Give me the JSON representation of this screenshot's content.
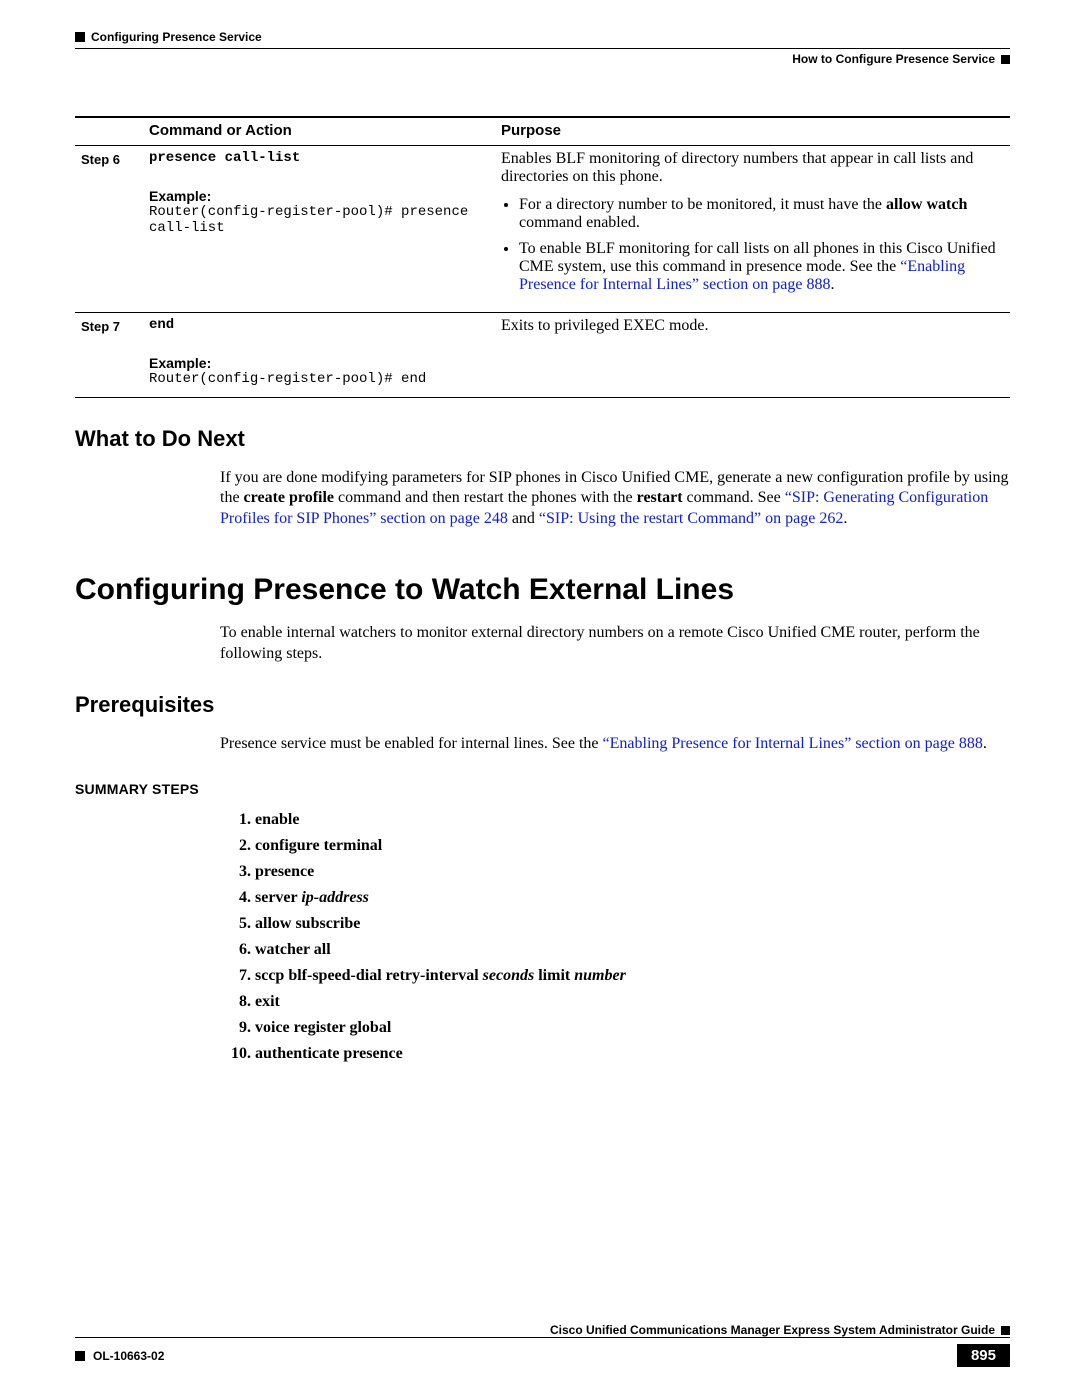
{
  "header": {
    "chapter": "Configuring Presence Service",
    "section": "How to Configure Presence Service"
  },
  "table": {
    "col1": "Command or Action",
    "col2": "Purpose",
    "rows": [
      {
        "step": "Step 6",
        "command": "presence call-list",
        "example_label": "Example:",
        "example_code": "Router(config-register-pool)# presence call-list",
        "purpose_intro": "Enables BLF monitoring of directory numbers that appear in call lists and directories on this phone.",
        "bullets": [
          {
            "pre": "For a directory number to be monitored, it must have the ",
            "bold": "allow watch",
            "post": " command enabled."
          },
          {
            "pre": "To enable BLF monitoring for call lists on all phones in this Cisco Unified CME system, use this command in presence mode. See the ",
            "link": "“Enabling Presence for Internal Lines” section on page 888",
            "post": "."
          }
        ]
      },
      {
        "step": "Step 7",
        "command": "end",
        "example_label": "Example:",
        "example_code": "Router(config-register-pool)# end",
        "purpose_intro": "Exits to privileged EXEC mode."
      }
    ]
  },
  "what_next": {
    "heading": "What to Do Next",
    "p_pre": "If you are done modifying parameters for SIP phones in Cisco Unified CME, generate a new configuration profile by using the ",
    "bold1": "create profile",
    "p_mid": " command and then restart the phones with the ",
    "bold2": "restart",
    "p_post": " command. See ",
    "link1": "“SIP: Generating Configuration Profiles for SIP Phones” section on page 248",
    "and": " and ",
    "link2": "“SIP: Using the restart Command” on page 262",
    "end": "."
  },
  "main_heading": "Configuring Presence to Watch External Lines",
  "main_intro": "To enable internal watchers to monitor external directory numbers on a remote Cisco Unified CME router, perform the following steps.",
  "prereq": {
    "heading": "Prerequisites",
    "pre": "Presence service must be enabled for internal lines. See the ",
    "link": "“Enabling Presence for Internal Lines” section on page 888",
    "post": "."
  },
  "summary_heading": "SUMMARY STEPS",
  "steps": [
    {
      "text": "enable"
    },
    {
      "text": "configure terminal"
    },
    {
      "text": "presence"
    },
    {
      "text": "server ",
      "italic": "ip-address"
    },
    {
      "text": "allow subscribe"
    },
    {
      "text": "watcher all"
    },
    {
      "text": "sccp blf-speed-dial retry-interval ",
      "italic": "seconds",
      "text2": " limit ",
      "italic2": "number"
    },
    {
      "text": "exit"
    },
    {
      "text": "voice register global"
    },
    {
      "text": "authenticate presence"
    }
  ],
  "footer": {
    "guide_title": "Cisco Unified Communications Manager Express System Administrator Guide",
    "doc_id": "OL-10663-02",
    "page": "895"
  }
}
